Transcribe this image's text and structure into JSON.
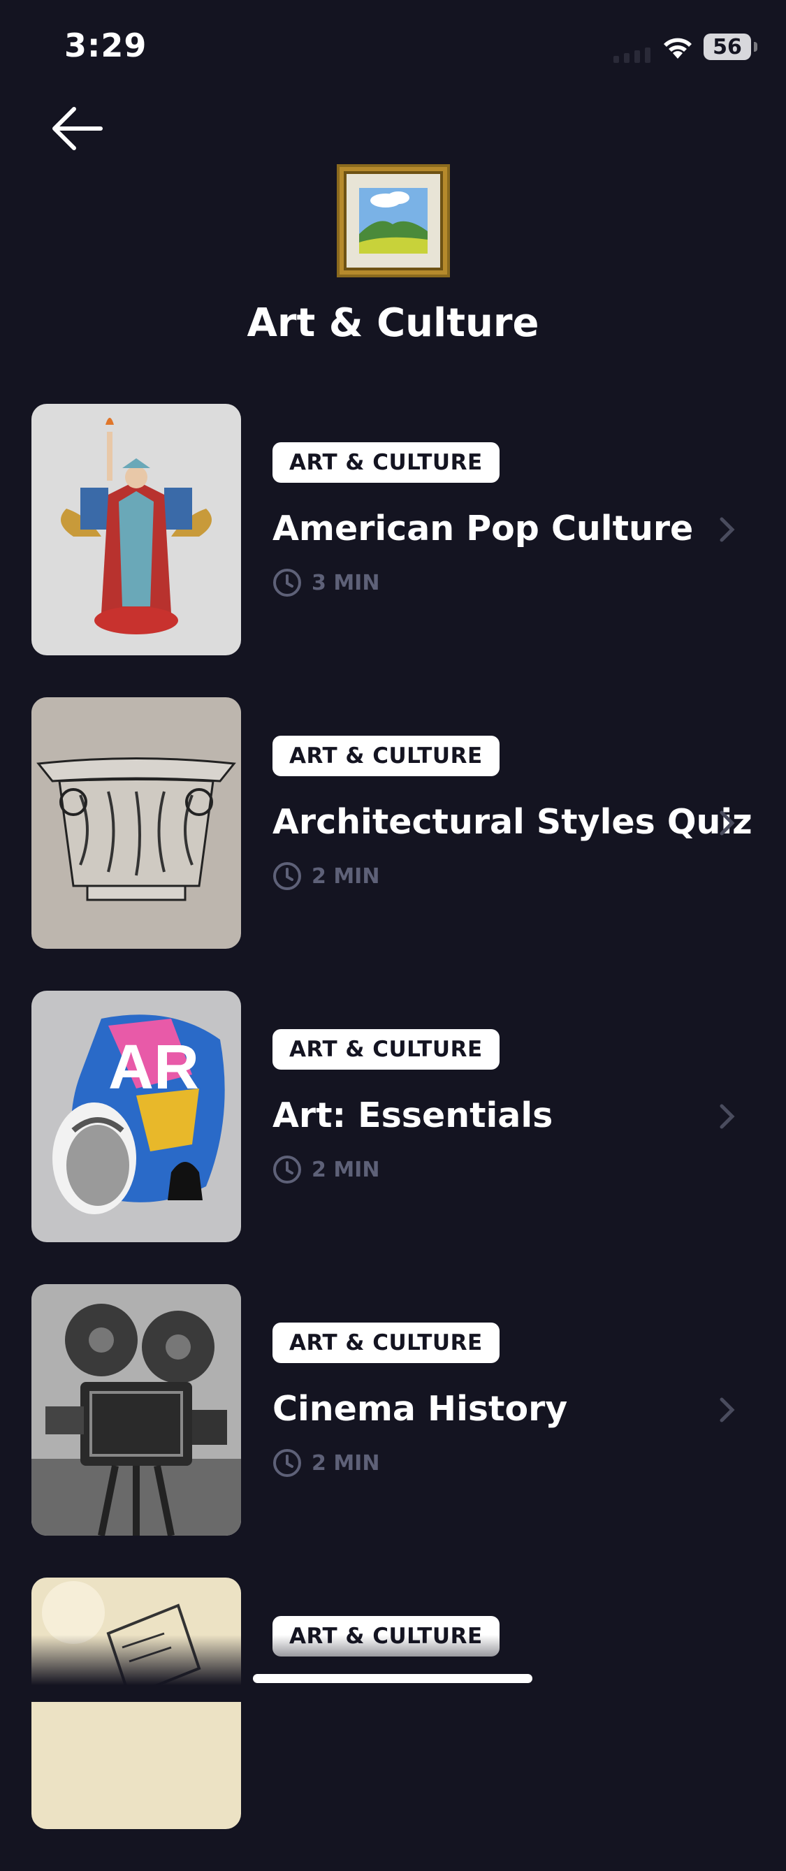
{
  "status_bar": {
    "time": "3:29",
    "battery": "56"
  },
  "header": {
    "title": "Art & Culture",
    "icon": "framed-picture-icon"
  },
  "items": [
    {
      "badge": "ART & CULTURE",
      "title": "American Pop Culture",
      "duration": "3 MIN",
      "thumb": "statue-of-liberty-illustration"
    },
    {
      "badge": "ART & CULTURE",
      "title": "Architectural Styles Quiz",
      "duration": "2 MIN",
      "thumb": "corinthian-capital-illustration"
    },
    {
      "badge": "ART & CULTURE",
      "title": "Art: Essentials",
      "duration": "2 MIN",
      "thumb": "art-collage-illustration"
    },
    {
      "badge": "ART & CULTURE",
      "title": "Cinema History",
      "duration": "2 MIN",
      "thumb": "film-camera-photo"
    },
    {
      "badge": "ART & CULTURE",
      "title": "",
      "duration": "",
      "thumb": "book-sketch-illustration"
    }
  ],
  "colors": {
    "background": "#141421",
    "badge_bg": "#ffffff",
    "muted": "#5e6178"
  }
}
